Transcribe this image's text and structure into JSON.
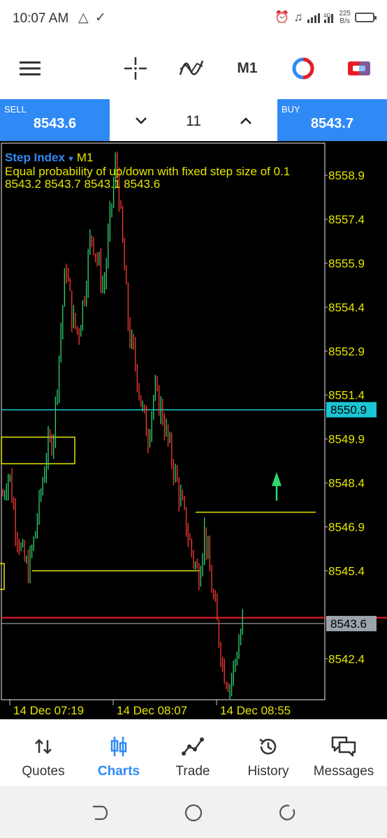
{
  "status": {
    "time": "10:07 AM",
    "left_icons": "△ ✓",
    "net_speed_value": "225",
    "net_speed_unit": "B/s",
    "network": "4G"
  },
  "toolbar": {
    "timeframe": "M1",
    "icons": [
      "menu-icon",
      "crosshair-icon",
      "indicators-icon",
      "objects-icon",
      "one-click-trading-icon"
    ]
  },
  "trade": {
    "sell_label": "SELL",
    "sell_price": "8543.6",
    "buy_label": "BUY",
    "buy_price": "8543.7",
    "lot": "11"
  },
  "chart": {
    "symbol": "Step Index",
    "timeframe": "M1",
    "description": "Equal probability of up/down with fixed step size of 0.1",
    "ohlc": "8543.2 8543.7 8543.1 8543.6",
    "current_price_label": "8543.6",
    "hline_label": "8550.9"
  },
  "chart_data": {
    "type": "bar",
    "symbol": "Step Index",
    "timeframe": "M1",
    "y_ticks": [
      "8558.9",
      "8557.4",
      "8555.9",
      "8554.4",
      "8552.9",
      "8551.4",
      "8549.9",
      "8548.4",
      "8546.9",
      "8545.4",
      "8542.4"
    ],
    "x_ticks": [
      "14 Dec 07:19",
      "14 Dec 08:07",
      "14 Dec 08:55"
    ],
    "ylim": [
      8541.0,
      8560.0
    ],
    "close_path": [
      8548.0,
      8548.8,
      8547.0,
      8546.0,
      8545.4,
      8546.5,
      8548.0,
      8549.5,
      8550.0,
      8553.0,
      8555.9,
      8554.0,
      8553.5,
      8555.0,
      8557.0,
      8556.0,
      8555.0,
      8557.4,
      8559.5,
      8556.5,
      8553.5,
      8552.5,
      8551.0,
      8550.0,
      8551.5,
      8551.0,
      8550.0,
      8549.0,
      8548.0,
      8547.0,
      8546.0,
      8545.2,
      8546.8,
      8545.0,
      8543.5,
      8542.0,
      8541.5,
      8542.5,
      8543.6
    ],
    "levels": {
      "current_price": 8543.6,
      "blue_line": 8550.9,
      "red_line": 8543.8,
      "yellow_lines": [
        8545.4,
        8547.4
      ]
    },
    "colors": {
      "up_bar": "#2ed573",
      "down_bar": "#ff3b30",
      "axis_text": "#e6e600",
      "blue_line": "#19c6d4",
      "red_line": "#e81c24"
    }
  },
  "nav": {
    "quotes": "Quotes",
    "charts": "Charts",
    "trade": "Trade",
    "history": "History",
    "messages": "Messages"
  },
  "colors": {
    "accent": "#2f8af5",
    "chart_bg": "#000000"
  }
}
